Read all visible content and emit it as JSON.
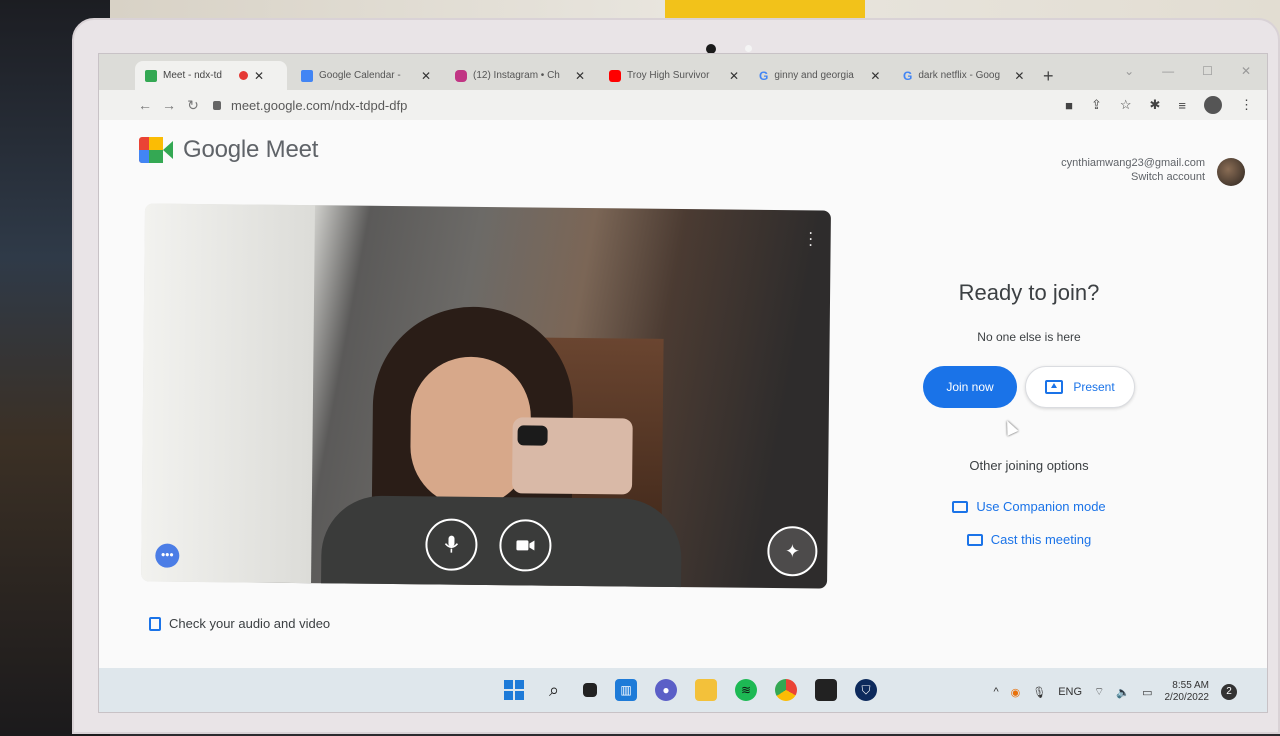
{
  "browser": {
    "tabs": [
      {
        "label": "Meet - ndx-td",
        "favicon_color": "#34a853",
        "active": true,
        "recording": true
      },
      {
        "label": "Google Calendar -",
        "favicon_color": "#4285f4",
        "active": false
      },
      {
        "label": "(12) Instagram • Ch",
        "favicon_color": "#c13584",
        "active": false
      },
      {
        "label": "Troy High Survivor",
        "favicon_color": "#ff0000",
        "active": false
      },
      {
        "label": "ginny and georgia",
        "favicon_color": "#4285f4",
        "active": false
      },
      {
        "label": "dark netflix - Goog",
        "favicon_color": "#4285f4",
        "active": false
      }
    ],
    "new_tab_label": "+",
    "url": "meet.google.com/ndx-tdpd-dfp"
  },
  "meet": {
    "logo_text": "Google Meet",
    "account_email": "cynthiamwang23@gmail.com",
    "switch_account_label": "Switch account",
    "ready_title": "Ready to join?",
    "participants_text": "No one else is here",
    "join_label": "Join now",
    "present_label": "Present",
    "other_options_label": "Other joining options",
    "companion_label": "Use Companion mode",
    "cast_label": "Cast this meeting",
    "check_av_label": "Check your audio and video",
    "accent_color": "#1a73e8"
  },
  "taskbar": {
    "lang": "ENG",
    "time": "8:55 AM",
    "date": "2/20/2022",
    "notification_count": "2"
  }
}
